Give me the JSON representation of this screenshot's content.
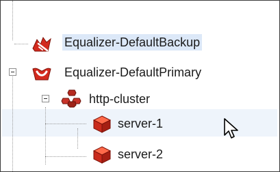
{
  "tree": {
    "nodes": [
      {
        "label": "Equalizer-DefaultBackup",
        "icon": "equalizer-backup-icon",
        "expanded": false,
        "selected": true
      },
      {
        "label": "Equalizer-DefaultPrimary",
        "icon": "equalizer-primary-icon",
        "expanded": true,
        "selected": false
      },
      {
        "label": "http-cluster",
        "icon": "cluster-icon",
        "expanded": true,
        "selected": false
      },
      {
        "label": "server-1",
        "icon": "server-icon",
        "selected": false,
        "hovered": true
      },
      {
        "label": "server-2",
        "icon": "server-icon",
        "selected": false
      }
    ]
  },
  "colors": {
    "selection": "#dce8f8",
    "hover_row": "#eef4fb",
    "icon_red": "#d32a1e"
  },
  "cursor": {
    "icon": "mouse-pointer-icon"
  }
}
